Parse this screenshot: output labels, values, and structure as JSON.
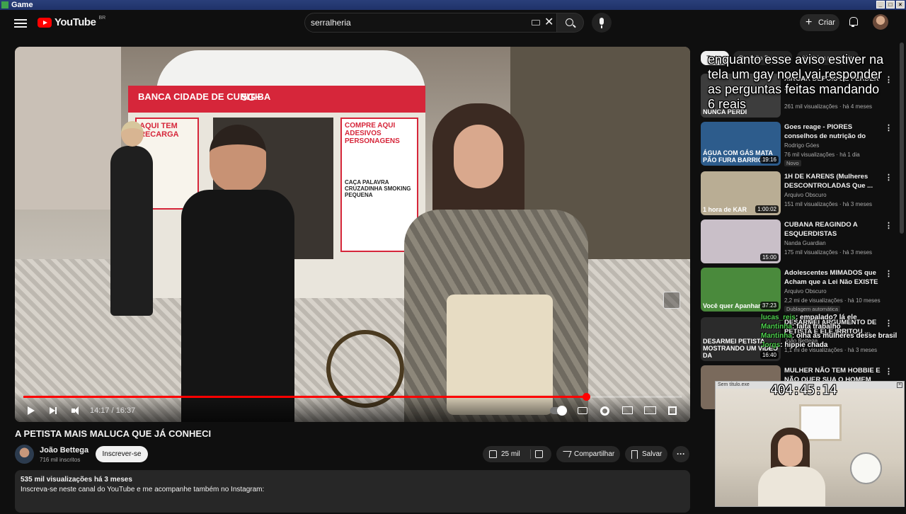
{
  "window": {
    "title": "Game"
  },
  "header": {
    "logo_text": "YouTube",
    "logo_country": "BR",
    "search_value": "serralheria",
    "create_label": "Criar"
  },
  "player": {
    "current_time": "14:17",
    "duration": "16:37",
    "time_display": "14:17 / 16:37",
    "progress_fraction": 0.855,
    "scene_text": {
      "kiosk_left": "BANCA CIDADE DE CURITIBA",
      "kiosk_right": "BANCA CIDADE DE CURITIBA",
      "badge_5g": "5G+",
      "sign_recarga": "AQUI TEM RECARGA",
      "sign_adesivos": "COMPRE AQUI ADESIVOS PERSONAGENS",
      "sign_list": "CAÇA PALAVRA CRUZADINHA SMOKING PEQUENA"
    }
  },
  "video": {
    "title": "A PETISTA MAIS MALUCA QUE JÁ CONHECI",
    "channel_name": "João Bettega",
    "channel_subs": "716 mil inscritos",
    "subscribe_label": "Inscrever-se",
    "likes": "25 mil",
    "share_label": "Compartilhar",
    "save_label": "Salvar",
    "views_date": "535 mil visualizações  há 3 meses",
    "description": "Inscreva-se neste canal do YouTube e me acompanhe também no Instagram:"
  },
  "sidebar": {
    "chips": [
      "Todos",
      "De João Bettega",
      "Notícias mundiais"
    ],
    "recommendations": [
      {
        "title": "XINGAR DEPOIS DE PERDER ...",
        "channel": "",
        "meta": "261 mil visualizações · há 4 meses",
        "duration": "",
        "thumb_caption": "NUNCA PERDI",
        "badge": "",
        "thumb_color": "#3d3d3d"
      },
      {
        "title": "Goes reage - PIORES conselhos de nutrição do TikTok",
        "channel": "Rodrigo Góes",
        "meta": "76 mil visualizações · há 1 dia",
        "duration": "19:16",
        "thumb_caption": "ÁGUA COM GÁS MATA PÃO FURA BARRIGA",
        "badge": "Novo",
        "thumb_color": "#2d5c8c"
      },
      {
        "title": "1H DE KARENS (Mulheres DESCONTROLADAS Que ...",
        "channel": "Arquivo Obscuro",
        "meta": "151 mil visualizações · há 3 meses",
        "duration": "1:00:02",
        "thumb_caption": "1 hora de KAR",
        "badge": "",
        "thumb_color": "#b9ad94"
      },
      {
        "title": "CUBANA REAGINDO A ESQUERDISTAS DEFENDENDO...",
        "channel": "Nanda Guardian",
        "meta": "175 mil visualizações · há 3 meses",
        "duration": "15:00",
        "thumb_caption": "",
        "badge": "",
        "thumb_color": "#c9bfc8"
      },
      {
        "title": "Adolescentes MIMADOS que Acham que a Lei Não EXISTE",
        "channel": "Arquivo Obscuro",
        "meta": "2,2 mi de visualizações · há 10 meses",
        "duration": "37:23",
        "thumb_caption": "Você quer Apanhar?",
        "badge": "Dublagem automática",
        "thumb_color": "#4a8a3c"
      },
      {
        "title": "DESARMEI ARGUMENTO DE PETISTA E ELE IRRITOU ...",
        "channel": "João Bettega",
        "meta": "1,1 mi de visualizações · há 3 meses",
        "duration": "16:40",
        "thumb_caption": "DESARMEI PETISTA MOSTRANDO UM VÍDEO DA",
        "badge": "",
        "thumb_color": "#2b2b2b"
      },
      {
        "title": "MULHER NÃO TEM HOBBIE E NÃO QUER SUA O HOMEM",
        "channel": "",
        "meta": "",
        "duration": "",
        "thumb_caption": "",
        "badge": "",
        "thumb_color": "#7a6a5c"
      }
    ]
  },
  "stream_overlay": {
    "notice": "enquanto esse aviso estiver na tela um gay noel vai responder as perguntas feitas mandando 6 reais",
    "timer": "404:45:14",
    "webcam_title": "Sem título.exe",
    "chat": [
      {
        "user": "lucas_reis",
        "text": ": empalado? lá ele"
      },
      {
        "user": "Mantinha",
        "text": ": falta trabalho"
      },
      {
        "user": "Mantinha",
        "text": ": olha as mulheres desse brasil"
      },
      {
        "user": "Jorgs",
        "text": ": hippie chada"
      }
    ]
  }
}
